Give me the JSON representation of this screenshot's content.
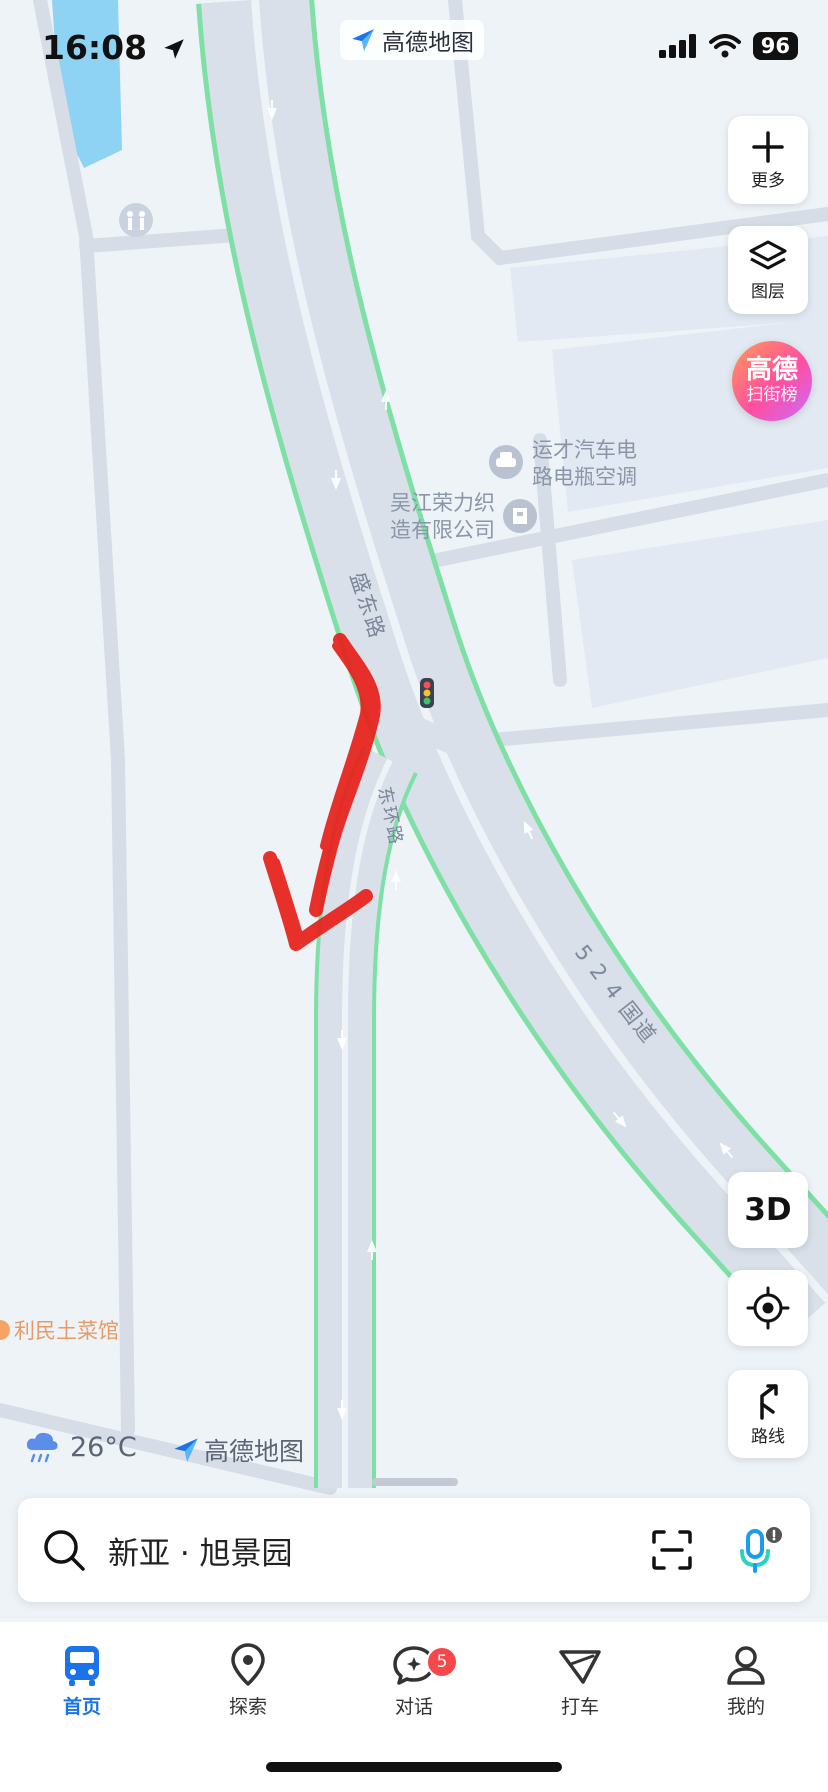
{
  "status_bar": {
    "time": "16:08",
    "battery": "96"
  },
  "brand_chip": {
    "label": "高德地图"
  },
  "map": {
    "pois": [
      {
        "name": "运才汽车电路电瓶空调"
      },
      {
        "name": "吴江荣力织造有限公司"
      },
      {
        "name": "利民土菜馆"
      }
    ],
    "roads": [
      "盛东路",
      "东环路",
      "5 2 4 国道"
    ],
    "annotation_color": "#e8201a"
  },
  "controls": {
    "more_label": "更多",
    "layers_label": "图层",
    "rank_line1": "高德",
    "rank_line2": "扫街榜",
    "mode_3d": "3D",
    "route_label": "路线"
  },
  "weather": {
    "temperature": "26°C",
    "icon": "rain-cloud-icon"
  },
  "watermark": {
    "label": "高德地图"
  },
  "search": {
    "value": "新亚 · 旭景园"
  },
  "tabbar": {
    "tabs": [
      {
        "label": "首页",
        "icon": "bus-icon",
        "active": true
      },
      {
        "label": "探索",
        "icon": "pin-icon"
      },
      {
        "label": "对话",
        "icon": "chat-icon",
        "badge": "5"
      },
      {
        "label": "打车",
        "icon": "taxi-icon"
      },
      {
        "label": "我的",
        "icon": "profile-icon"
      }
    ]
  },
  "colors": {
    "accent": "#1a73e8",
    "road_edge": "#7ee0a4",
    "water": "#8fd3f4"
  }
}
